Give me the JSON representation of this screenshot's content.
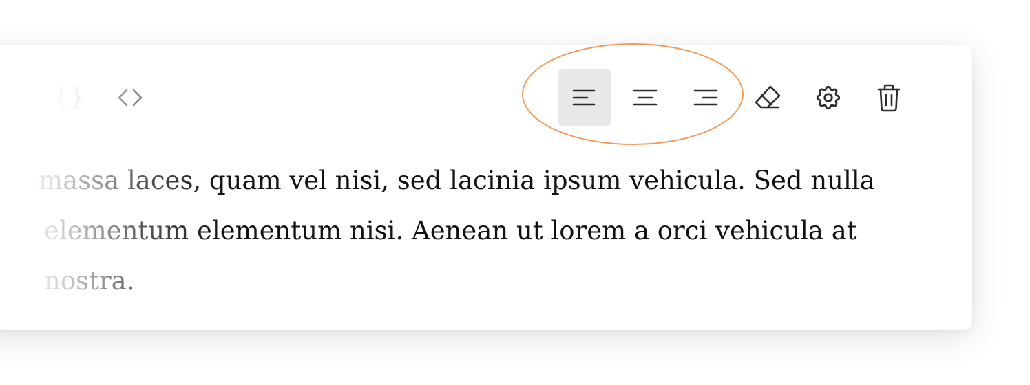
{
  "toolbar": {
    "code_block_glyph": "{}",
    "items": [
      {
        "icon": "code-icon",
        "label": "Inline code"
      },
      {
        "icon": "align-left-icon",
        "label": "Align left",
        "active": true
      },
      {
        "icon": "align-center-icon",
        "label": "Align center"
      },
      {
        "icon": "align-right-icon",
        "label": "Align right"
      },
      {
        "icon": "eraser-icon",
        "label": "Clear formatting"
      },
      {
        "icon": "gear-icon",
        "label": "Settings"
      },
      {
        "icon": "trash-icon",
        "label": "Delete"
      }
    ],
    "highlight_color": "#ef9a5a",
    "active_bg": "#e8e8eb"
  },
  "content": {
    "lines": [
      "massa laces, quam vel nisi, sed lacinia ipsum vehicula. Sed nulla",
      "elementum elementum nisi. Aenean ut lorem a orci vehicula at",
      "nostra."
    ]
  }
}
